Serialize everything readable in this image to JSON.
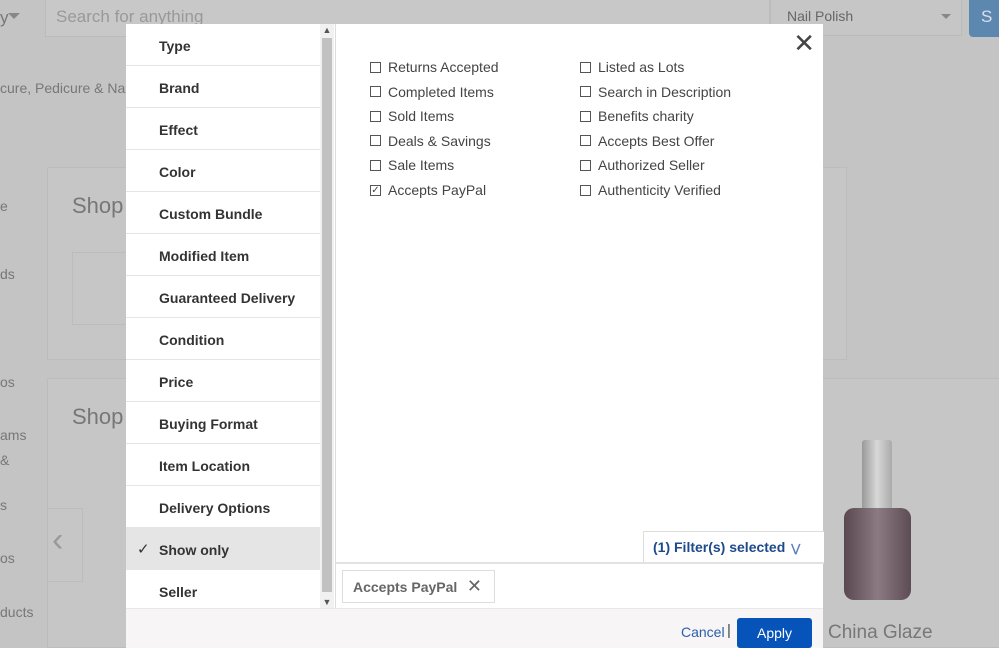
{
  "background": {
    "search_placeholder": "Search for anything",
    "category_select": "Nail Polish",
    "search_button": "S",
    "breadcrumb": "cure, Pedicure & Nail C",
    "sidebar_fragments": [
      "e",
      "ds",
      "os",
      "ams",
      "&",
      "s",
      "os",
      "ducts"
    ],
    "shop_headings": [
      "Shop",
      "Shop"
    ],
    "product_title": "China Glaze"
  },
  "modal": {
    "nav_items": [
      {
        "label": "Type"
      },
      {
        "label": "Brand"
      },
      {
        "label": "Effect"
      },
      {
        "label": "Color"
      },
      {
        "label": "Custom Bundle"
      },
      {
        "label": "Modified Item"
      },
      {
        "label": "Guaranteed Delivery"
      },
      {
        "label": "Condition"
      },
      {
        "label": "Price"
      },
      {
        "label": "Buying Format"
      },
      {
        "label": "Item Location"
      },
      {
        "label": "Delivery Options"
      },
      {
        "label": "Show only",
        "active": true
      },
      {
        "label": "Seller"
      }
    ],
    "options": [
      {
        "label": "Returns Accepted",
        "checked": false
      },
      {
        "label": "Completed Items",
        "checked": false
      },
      {
        "label": "Sold Items",
        "checked": false
      },
      {
        "label": "Deals & Savings",
        "checked": false
      },
      {
        "label": "Sale Items",
        "checked": false
      },
      {
        "label": "Accepts PayPal",
        "checked": true
      },
      {
        "label": "Listed as Lots",
        "checked": false
      },
      {
        "label": "Search in Description",
        "checked": false
      },
      {
        "label": "Benefits charity",
        "checked": false
      },
      {
        "label": "Accepts Best Offer",
        "checked": false
      },
      {
        "label": "Authorized Seller",
        "checked": false
      },
      {
        "label": "Authenticity Verified",
        "checked": false
      }
    ],
    "filters_selected": "(1) Filter(s) selected",
    "chip_label": "Accepts PayPal",
    "cancel": "Cancel",
    "separator": "|",
    "apply": "Apply",
    "accent": "#0654ba"
  }
}
